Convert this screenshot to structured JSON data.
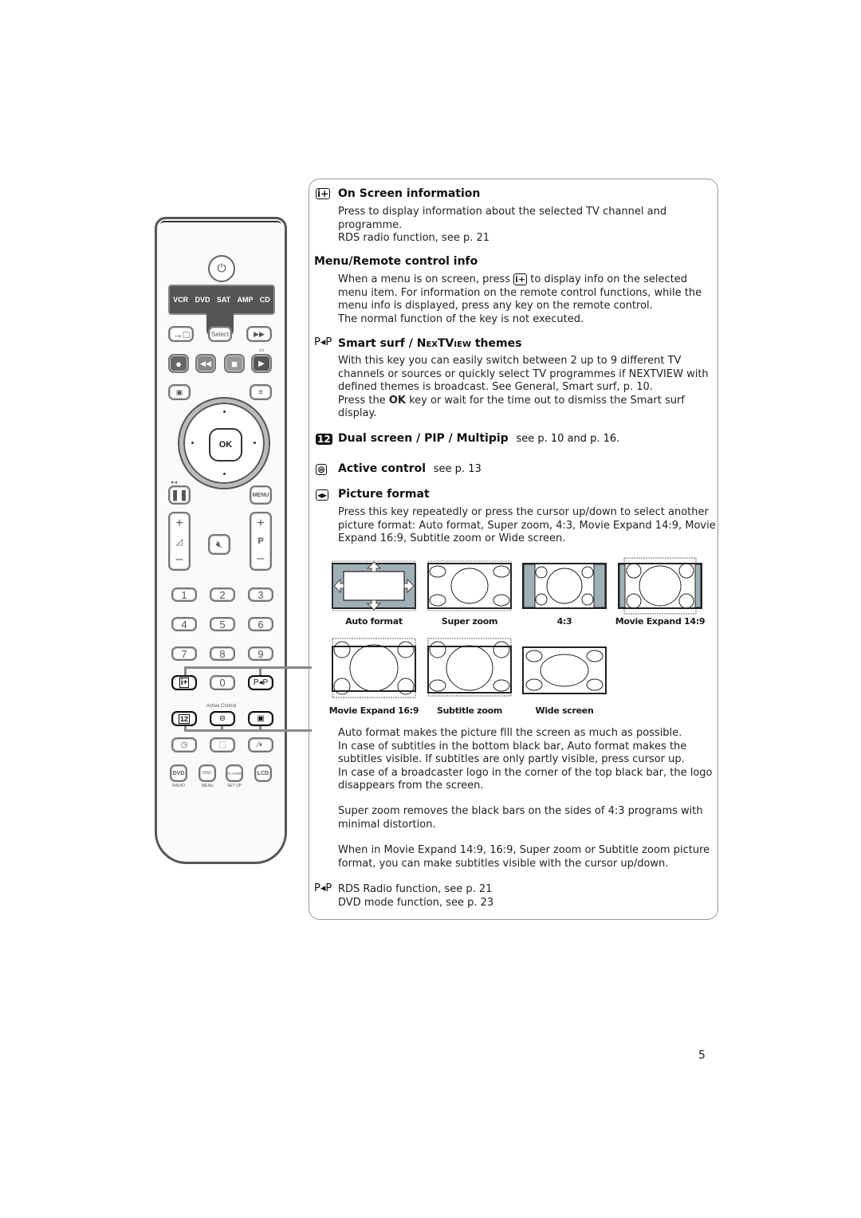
{
  "remote": {
    "mode_keys": [
      "VCR",
      "DVD",
      "SAT",
      "AMP",
      "CD"
    ],
    "select_label": "Select",
    "ok_label": "OK",
    "menu_label": "MENU",
    "p_label": "P",
    "plus": "+",
    "minus": "–",
    "digits": [
      "1",
      "2",
      "3",
      "4",
      "5",
      "6",
      "7",
      "8",
      "9",
      "0"
    ],
    "pip_label": "P◂P",
    "info_label": "i+",
    "dual_label": "12",
    "active_control_label": "Active Control",
    "bottom_keys": [
      {
        "label": "DVD",
        "sub": "RADIO"
      },
      {
        "label": "DISC",
        "sub": "MENU"
      },
      {
        "label": "PLAYER",
        "sub": "SET UP"
      },
      {
        "label": "LCD",
        "sub": ""
      }
    ]
  },
  "sections": {
    "on_screen": {
      "icon": "i+",
      "title": "On Screen information",
      "lines": [
        "Press to display information about the selected TV channel and",
        "programme.",
        "RDS radio function, see p. 21"
      ]
    },
    "menu_info": {
      "title": "Menu/Remote control info",
      "line1_pre": "When a menu is on screen, press",
      "line1_post": "to display info on the selected",
      "lines": [
        "menu item. For information on the remote control functions, while the",
        "menu info is displayed, press any key on the remote control.",
        "The normal function of the key is not executed."
      ]
    },
    "smart_surf": {
      "icon": "P◂P",
      "title_pre": "Smart surf / ",
      "title_sc": "NexTView",
      "title_post": " themes",
      "lines": [
        "With this key you can easily switch between 2 up to 9 different TV",
        "channels or sources or quickly select TV programmes if NEXTVIEW with",
        "defined themes is broadcast. See General, Smart surf, p. 10."
      ],
      "ok_line_pre": "Press the ",
      "ok_line_bold": "OK",
      "ok_line_post": " key or wait for the time out to dismiss the Smart surf",
      "ok_line2": "display."
    },
    "dual_screen": {
      "icon": "12",
      "title": "Dual screen / PIP / Multipip",
      "ref": "see p. 10 and p. 16."
    },
    "active_control": {
      "title": "Active control",
      "ref": "see p. 13"
    },
    "picture_format": {
      "title": "Picture format",
      "lines": [
        "Press this key repeatedly or press the cursor up/down to select another",
        "picture format: Auto format, Super zoom, 4:3, Movie Expand 14:9, Movie",
        "Expand 16:9, Subtitle zoom or Wide screen."
      ],
      "formats": [
        "Auto format",
        "Super zoom",
        "4:3",
        "Movie Expand 14:9",
        "Movie Expand 16:9",
        "Subtitle zoom",
        "Wide screen"
      ],
      "auto_lines": [
        "Auto format makes the picture fill the screen as much as possible.",
        "In case of subtitles in the bottom black bar, Auto format makes the",
        "subtitles visible.  If subtitles are only partly visible, press cursor up.",
        "In case of a broadcaster logo in the corner of the top black bar, the logo",
        "disappears from the screen."
      ],
      "super_lines": [
        "Super zoom removes the black bars on the sides of 4:3 programs with",
        "minimal distortion."
      ],
      "expand_lines": [
        "When in Movie Expand 14:9, 16:9, Super zoom or Subtitle zoom picture",
        "format, you can make subtitles visible with the cursor up/down."
      ]
    },
    "pip_footer": {
      "icon": "P◂P",
      "lines": [
        "RDS Radio function, see p. 21",
        "DVD mode function, see p. 23"
      ]
    }
  },
  "colors": {
    "screen_grey": "#9fb0b6",
    "key_dark": "#555555"
  },
  "page_number": "5"
}
